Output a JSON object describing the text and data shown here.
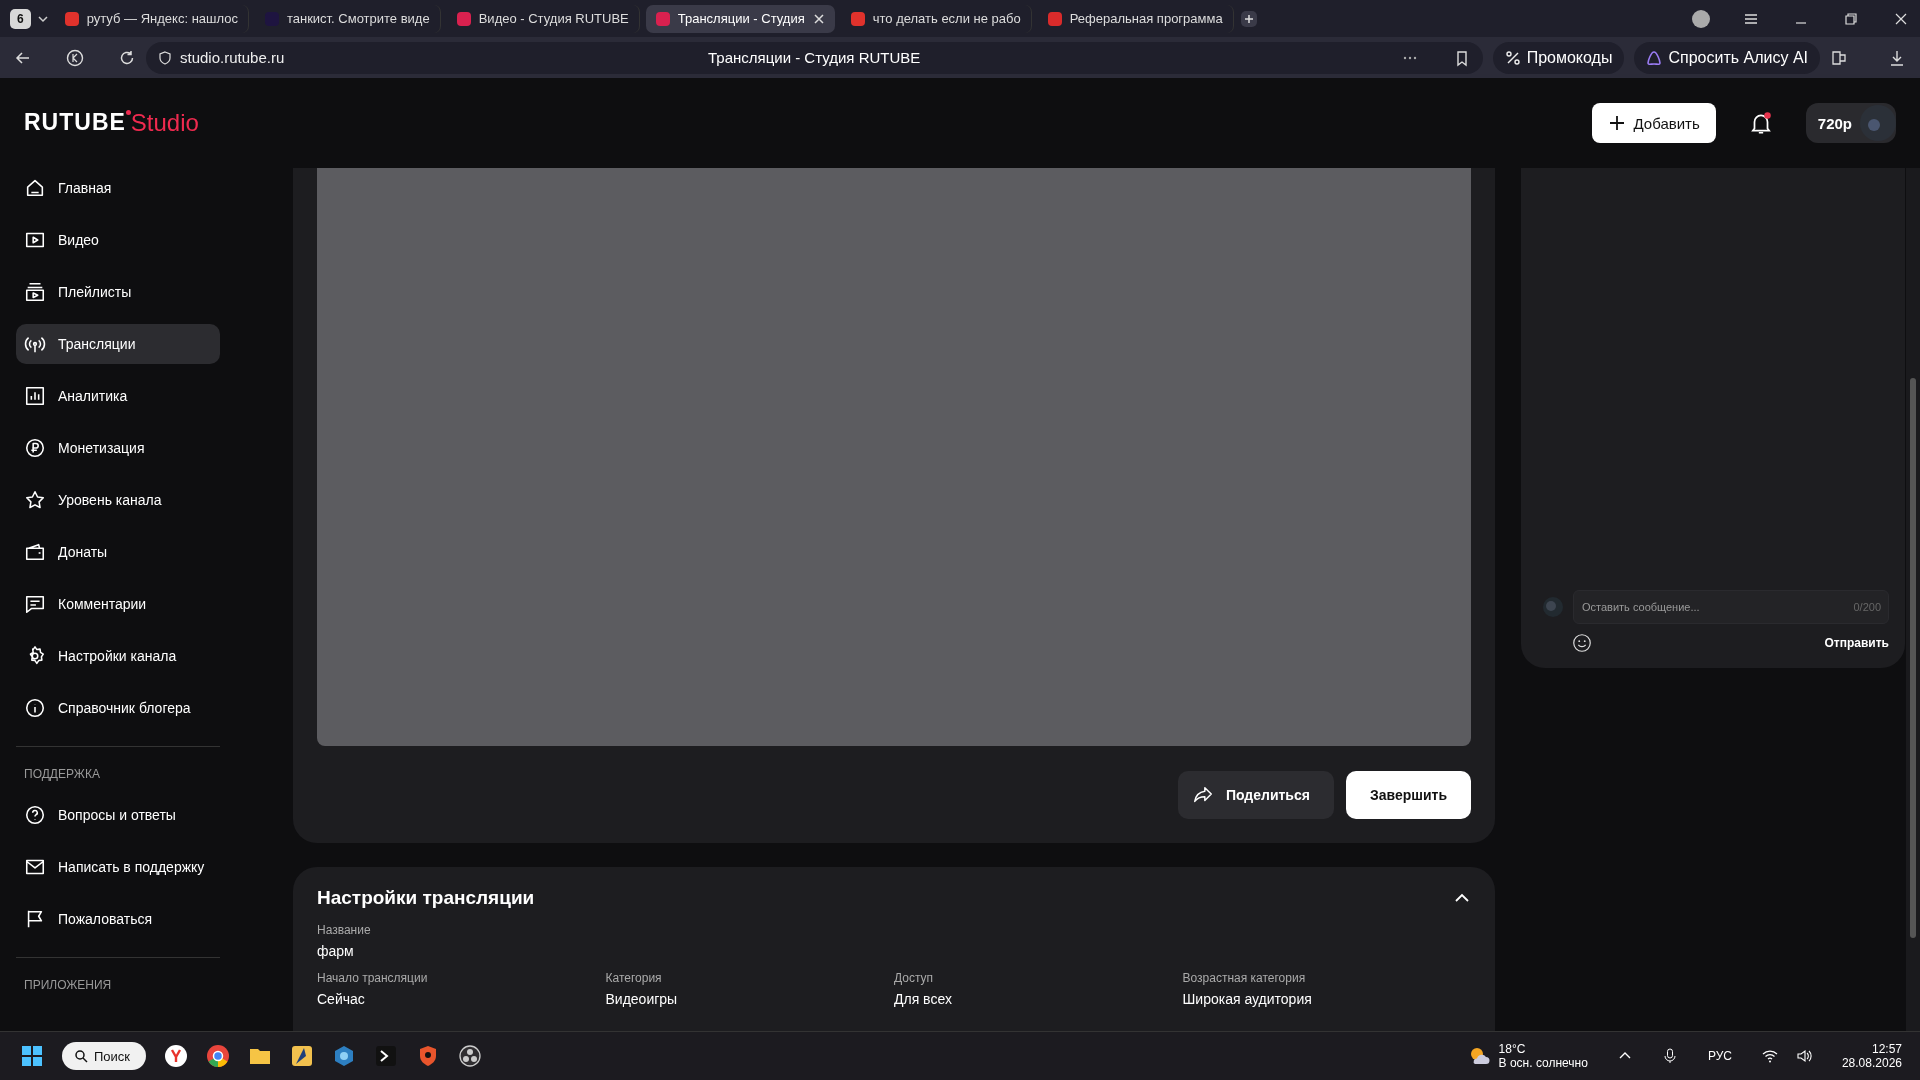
{
  "browser": {
    "tab_count": "6",
    "tabs": [
      {
        "title": "рутуб — Яндекс: нашлос",
        "selected": false
      },
      {
        "title": "танкист. Смотрите виде",
        "selected": false
      },
      {
        "title": "Видео - Студия RUTUBE",
        "selected": false
      },
      {
        "title": "Трансляции - Студия",
        "selected": true
      },
      {
        "title": "что делать если не рабо",
        "selected": false
      },
      {
        "title": "Реферальная программа",
        "selected": false
      }
    ],
    "address": "studio.rutube.ru",
    "page_title": "Трансляции - Студия RUTUBE",
    "promo_button": "Промокоды",
    "alice_button": "Спросить Алису AI"
  },
  "header": {
    "logo": "RUTUBE",
    "logo_suffix": "Studio",
    "add_button": "Добавить",
    "notifications": true,
    "quality": "720p"
  },
  "sidebar": {
    "items": [
      {
        "label": "Главная",
        "selected": false
      },
      {
        "label": "Видео",
        "selected": false
      },
      {
        "label": "Плейлисты",
        "selected": false
      },
      {
        "label": "Трансляции",
        "selected": true
      },
      {
        "label": "Аналитика",
        "selected": false
      },
      {
        "label": "Монетизация",
        "selected": false
      },
      {
        "label": "Уровень канала",
        "selected": false
      },
      {
        "label": "Донаты",
        "selected": false
      },
      {
        "label": "Комментарии",
        "selected": false
      },
      {
        "label": "Настройки канала",
        "selected": false
      },
      {
        "label": "Справочник блогера",
        "selected": false
      }
    ],
    "support_heading": "ПОДДЕРЖКА",
    "support_items": [
      {
        "label": "Вопросы и ответы"
      },
      {
        "label": "Написать в поддержку"
      },
      {
        "label": "Пожаловаться"
      }
    ],
    "apps_heading": "ПРИЛОЖЕНИЯ"
  },
  "stream": {
    "share_button": "Поделиться",
    "finish_button": "Завершить"
  },
  "chat": {
    "placeholder": "Оставить сообщение...",
    "counter": "0/200",
    "send_button": "Отправить"
  },
  "settings": {
    "title": "Настройки трансляции",
    "expanded": true,
    "fields": [
      {
        "label": "Название",
        "value": "фарм"
      },
      {
        "label": "Начало трансляции",
        "value": "Сейчас"
      },
      {
        "label": "Категория",
        "value": "Видеоигры"
      },
      {
        "label": "Доступ",
        "value": "Для всех"
      },
      {
        "label": "Возрастная категория",
        "value": "Широкая аудитория"
      }
    ]
  },
  "taskbar": {
    "search": "Поиск",
    "temperature": "18°C",
    "weather": "В осн. солнечно",
    "language": "РУС",
    "time": "12:57",
    "date": "28.08.2026"
  }
}
